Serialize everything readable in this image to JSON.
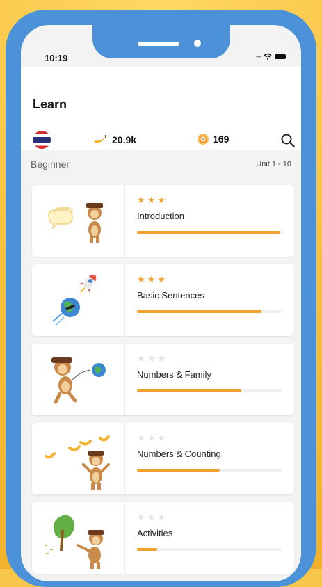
{
  "status_bar": {
    "time": "10:19"
  },
  "header": {
    "title": "Learn",
    "bananas": "20.9k",
    "coins": "169"
  },
  "section": {
    "level": "Beginner",
    "units": "Unit 1 - 10"
  },
  "lessons": [
    {
      "name": "Introduction",
      "stars_earned": 3,
      "progress": 0.99
    },
    {
      "name": "Basic Sentences",
      "stars_earned": 3,
      "progress": 0.86
    },
    {
      "name": "Numbers & Family",
      "stars_earned": 0,
      "progress": 0.72
    },
    {
      "name": "Numbers & Counting",
      "stars_earned": 0,
      "progress": 0.57
    },
    {
      "name": "Activities",
      "stars_earned": 0,
      "progress": 0.14
    }
  ],
  "colors": {
    "accent": "#f0a12e",
    "frame": "#4b92d8",
    "background": "#f6bf3a"
  }
}
